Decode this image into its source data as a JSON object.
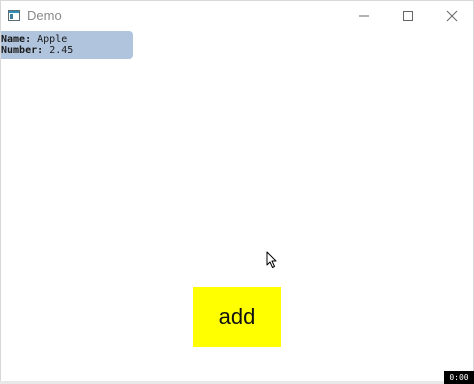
{
  "window": {
    "title": "Demo"
  },
  "info": {
    "name_label": "Name:",
    "name_value": "Apple",
    "number_label": "Number:",
    "number_value": "2.45",
    "background_color": "#b0c4de"
  },
  "actions": {
    "add_label": "add",
    "add_color": "#ffff00"
  },
  "recorder": {
    "timer": "0:00"
  },
  "icons": {
    "app": "app-window-icon",
    "minimize": "minimize-icon",
    "maximize": "maximize-icon",
    "close": "close-icon",
    "cursor": "mouse-pointer-icon"
  }
}
